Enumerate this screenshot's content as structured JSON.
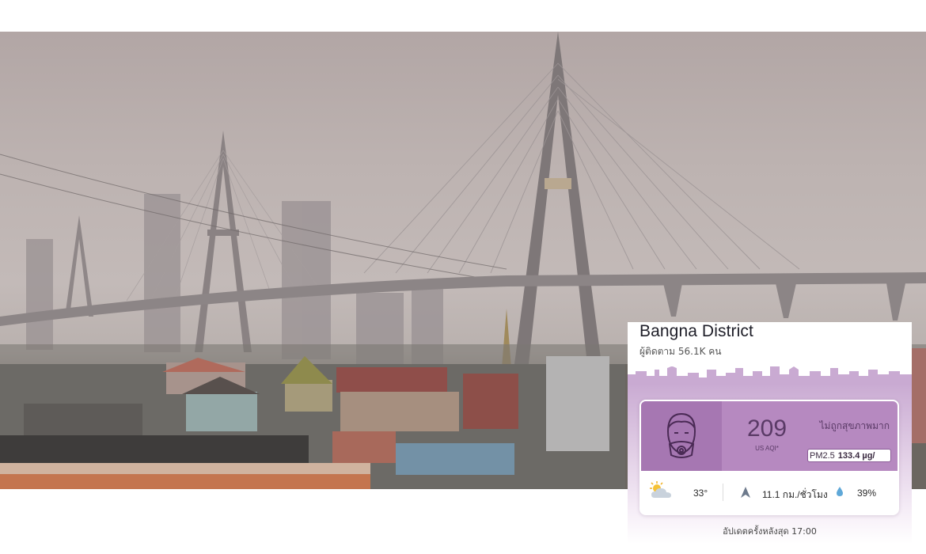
{
  "widget": {
    "location_name": "Bangna District",
    "followers_text": "ผู้ติดตาม 56.1K คน",
    "aqi": {
      "value": "209",
      "unit": "US AQI*",
      "status": "ไม่ถูกสุขภาพมาก",
      "pollutant_label": "PM2.5",
      "pollutant_value": "133.4 µg/",
      "level_color": "#b689c0"
    },
    "weather": {
      "icon": "partly-cloudy-icon",
      "temperature": "33°",
      "wind_icon": "wind-direction-icon",
      "wind_speed": "11.1 กม./ชั่วโมง",
      "humidity_icon": "humidity-drop-icon",
      "humidity": "39%"
    },
    "updated_text": "อัปเดตครั้งหลังสุด 17:00"
  },
  "colors": {
    "accent_purple": "#b689c0",
    "dark_purple": "#a677b2",
    "text_purple": "#5a3a66"
  }
}
